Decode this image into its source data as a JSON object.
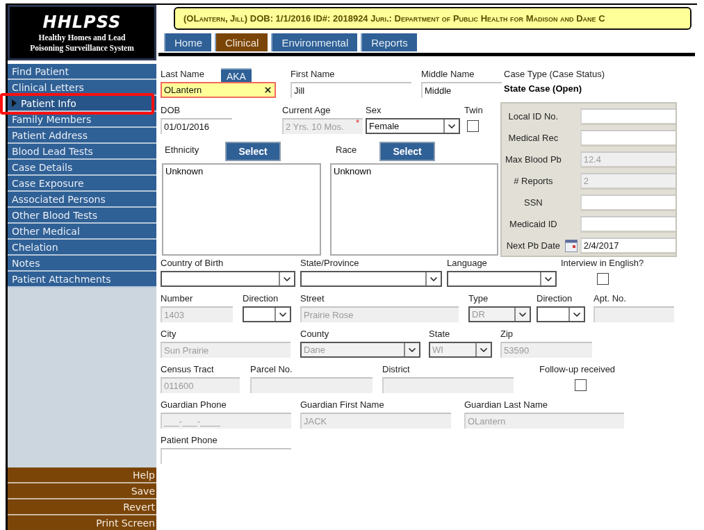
{
  "logo": {
    "title": "HHLPSS",
    "subtitle_lines": [
      "Healthy Homes and Lead",
      "Poisoning Surveillance System"
    ]
  },
  "banner": "(OLantern, Jill) DOB: 1/1/2016 ID#: 2018924 Juri.: Department of Public Health for Madison and Dane C",
  "tabs": [
    {
      "label": "Home",
      "selected": false
    },
    {
      "label": "Clinical",
      "selected": true
    },
    {
      "label": "Environmental",
      "selected": false
    },
    {
      "label": "Reports",
      "selected": false
    }
  ],
  "sidebar": {
    "items": [
      {
        "label": "Find Patient",
        "selected": false,
        "annotated": false
      },
      {
        "label": "Clinical Letters",
        "selected": false,
        "annotated": false
      },
      {
        "label": "Patient Info",
        "selected": true,
        "annotated": true
      },
      {
        "label": "Family Members",
        "selected": false,
        "annotated": false
      },
      {
        "label": "Patient Address",
        "selected": false,
        "annotated": false
      },
      {
        "label": "Blood Lead Tests",
        "selected": false,
        "annotated": false
      },
      {
        "label": "Case Details",
        "selected": false,
        "annotated": false
      },
      {
        "label": "Case Exposure",
        "selected": false,
        "annotated": false
      },
      {
        "label": "Associated Persons",
        "selected": false,
        "annotated": false
      },
      {
        "label": "Other Blood Tests",
        "selected": false,
        "annotated": false
      },
      {
        "label": "Other Medical",
        "selected": false,
        "annotated": false
      },
      {
        "label": "Chelation",
        "selected": false,
        "annotated": false
      },
      {
        "label": "Notes",
        "selected": false,
        "annotated": false
      },
      {
        "label": "Patient Attachments",
        "selected": false,
        "annotated": false
      }
    ],
    "actions": [
      "Help",
      "Save",
      "Revert",
      "Print Screen"
    ]
  },
  "identity_rows": [
    [
      {
        "kind": "text",
        "label": "Last Name",
        "tab": "AKA",
        "value": "OLantern",
        "highlighted": true,
        "disabled": false
      },
      {
        "kind": "text",
        "label": "First Name",
        "value": "Jill",
        "highlighted": false,
        "disabled": false
      },
      {
        "kind": "text",
        "label": "Middle Name",
        "value": "Middle",
        "highlighted": false,
        "disabled": false
      }
    ],
    [
      {
        "kind": "text",
        "label": "DOB",
        "value": "01/01/2016",
        "highlighted": false,
        "disabled": false
      },
      {
        "kind": "text",
        "label": "Current Age",
        "value": "2 Yrs. 10 Mos.",
        "highlighted": false,
        "disabled": true
      },
      {
        "kind": "select",
        "label": "Sex",
        "value": "Female",
        "disabled": false,
        "required_mark": "*"
      },
      {
        "kind": "checkbox",
        "label": "Twin",
        "checked": false
      }
    ]
  ],
  "pickers": [
    {
      "label": "Ethnicity",
      "button": "Select",
      "items": [
        "Unknown"
      ]
    },
    {
      "label": "Race",
      "button": "Select",
      "items": [
        "Unknown"
      ]
    }
  ],
  "case_type": {
    "label": "Case Type (Case Status)",
    "value": "State Case (Open)"
  },
  "id_panel": [
    {
      "kind": "text",
      "label": "Local ID No.",
      "disabled": false
    },
    {
      "kind": "text",
      "label": "Medical Rec",
      "disabled": false
    },
    {
      "kind": "text",
      "label": "Max Blood Pb",
      "value": "12.4",
      "disabled": true
    },
    {
      "kind": "text",
      "label": "# Reports",
      "value": "2",
      "disabled": true
    },
    {
      "kind": "text",
      "label": "SSN",
      "disabled": false
    },
    {
      "kind": "text",
      "label": "Medicaid ID",
      "disabled": false
    },
    {
      "kind": "date",
      "label": "Next Pb Date",
      "value": "2/4/2017",
      "disabled": false
    }
  ],
  "address_rows": [
    [
      {
        "kind": "select",
        "label": "Country of Birth",
        "disabled": false
      },
      {
        "kind": "select",
        "label": "State/Province",
        "disabled": false
      },
      {
        "kind": "select",
        "label": "Language",
        "disabled": false
      },
      {
        "kind": "checkbox",
        "label": "Interview in English?",
        "checked": false
      }
    ],
    [
      {
        "kind": "text",
        "label": "Number",
        "value": "1403",
        "highlighted": false,
        "disabled": true
      },
      {
        "kind": "select",
        "label": "Direction",
        "disabled": false
      },
      {
        "kind": "text",
        "label": "Street",
        "value": "Prairie Rose",
        "highlighted": false,
        "disabled": true
      },
      {
        "kind": "select",
        "label": "Type",
        "value": "DR",
        "disabled": true
      },
      {
        "kind": "select",
        "label": "Direction",
        "disabled": false
      },
      {
        "kind": "text",
        "label": "Apt. No.",
        "highlighted": false,
        "disabled": true
      }
    ],
    [
      {
        "kind": "text",
        "label": "City",
        "value": "Sun Prairie",
        "highlighted": false,
        "disabled": true
      },
      {
        "kind": "select",
        "label": "County",
        "value": "Dane",
        "disabled": true
      },
      {
        "kind": "select",
        "label": "State",
        "value": "WI",
        "disabled": true
      },
      {
        "kind": "text",
        "label": "Zip",
        "value": "53590",
        "highlighted": false,
        "disabled": true
      }
    ],
    [
      {
        "kind": "text",
        "label": "Census Tract",
        "value": "011600",
        "highlighted": false,
        "disabled": true
      },
      {
        "kind": "text",
        "label": "Parcel No.",
        "highlighted": false,
        "disabled": true
      },
      {
        "kind": "text",
        "label": "District",
        "highlighted": false,
        "disabled": true
      },
      {
        "kind": "checkbox",
        "label": "Follow-up received",
        "checked": false
      }
    ],
    [
      {
        "kind": "text",
        "label": "Guardian Phone",
        "value": "___-___-____",
        "highlighted": false,
        "disabled": true
      },
      {
        "kind": "text",
        "label": "Guardian First Name",
        "value": "JACK",
        "highlighted": false,
        "disabled": true
      },
      {
        "kind": "text",
        "label": "Guardian Last Name",
        "value": "OLantern",
        "highlighted": false,
        "disabled": true
      }
    ],
    [
      {
        "kind": "text",
        "label": "Patient Phone",
        "highlighted": false,
        "disabled": false
      }
    ]
  ]
}
